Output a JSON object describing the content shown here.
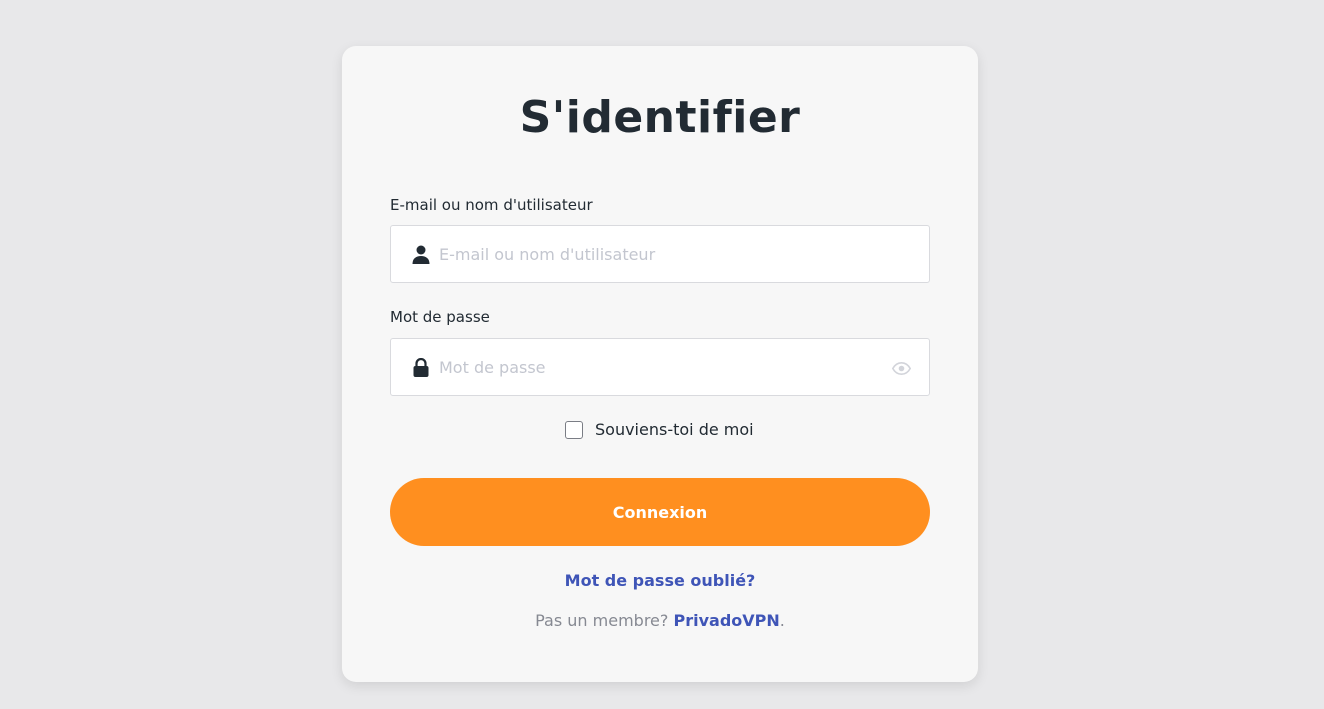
{
  "login": {
    "title": "S'identifier",
    "email_label": "E-mail ou nom d'utilisateur",
    "email_placeholder": "E-mail ou nom d'utilisateur",
    "email_value": "",
    "password_label": "Mot de passe",
    "password_placeholder": "Mot de passe",
    "password_value": "",
    "remember_label": "Souviens-toi de moi",
    "remember_checked": false,
    "submit_label": "Connexion",
    "forgot_label": "Mot de passe oublié?",
    "signup_prefix": "Pas un membre?",
    "signup_link": "PrivadoVPN",
    "signup_suffix": "."
  },
  "icons": {
    "email": "user-icon",
    "password": "lock-icon",
    "toggle_password": "eye-icon"
  },
  "colors": {
    "page_background": "#e8e8ea",
    "card_background": "#f7f7f7",
    "primary_button": "#ff8f1f",
    "link": "#3f55b7",
    "heading_text": "#222b33",
    "muted_text": "#868992"
  }
}
